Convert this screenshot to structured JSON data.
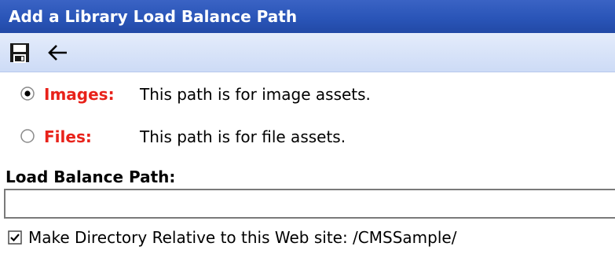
{
  "window": {
    "title": "Add a Library Load Balance Path"
  },
  "toolbar": {
    "save_icon": "save-icon",
    "back_icon": "back-arrow-icon"
  },
  "options": [
    {
      "label": "Images:",
      "description": "This path is for image assets.",
      "selected": true
    },
    {
      "label": "Files:",
      "description": "This path is for file assets.",
      "selected": false
    }
  ],
  "load_balance_path": {
    "label": "Load Balance Path:",
    "value": ""
  },
  "relative_directory": {
    "label": "Make Directory Relative to this Web site: /CMSSample/",
    "checked": true
  },
  "colors": {
    "title_bar": "#2a55b8",
    "toolbar": "#cddbf6",
    "option_label": "#e8221a"
  }
}
